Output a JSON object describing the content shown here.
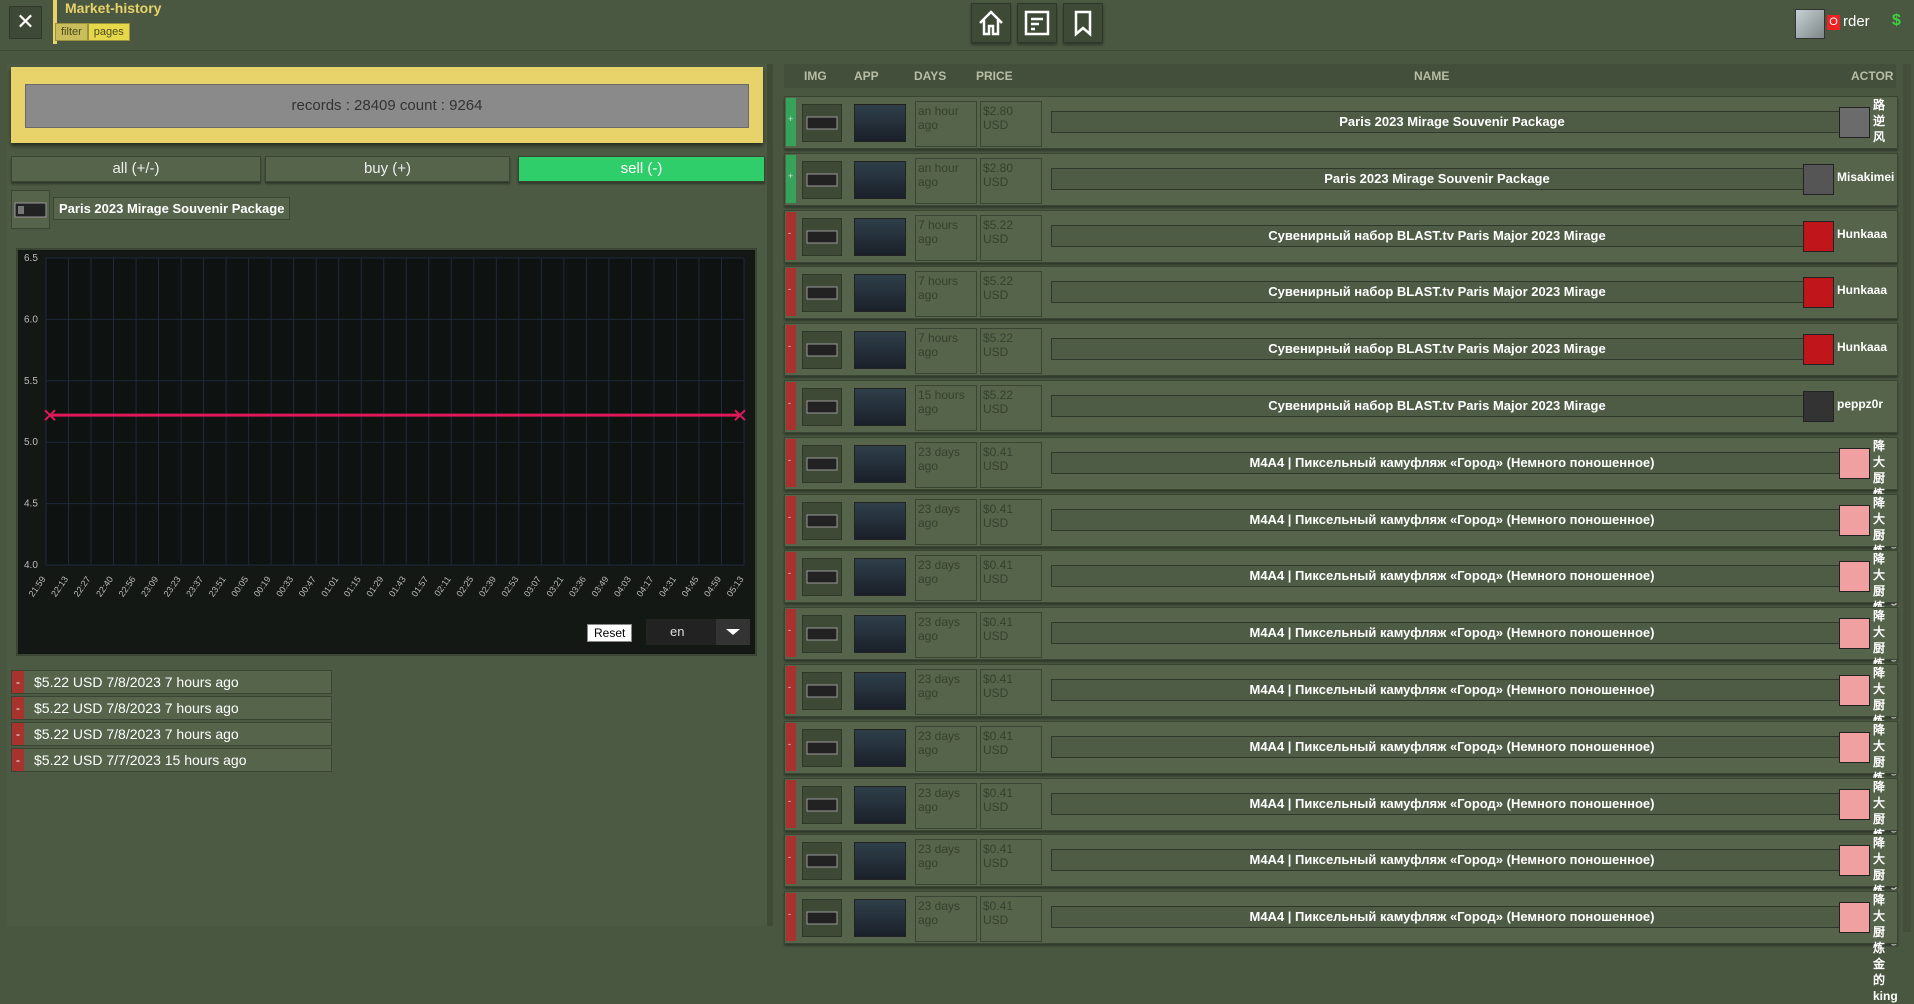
{
  "header": {
    "title": "Market-history",
    "tabs": [
      "filter",
      "pages"
    ],
    "close_label": "✕",
    "user": {
      "badge": "O",
      "name": "rder",
      "currency": "$"
    }
  },
  "left": {
    "records_text": "records : 28409 count : 9264",
    "filters": [
      "all (+/-)",
      "buy (+)",
      "sell (-)"
    ],
    "active_filter": "sell (-)",
    "item_name": "Paris 2023 Mirage Souvenir Package",
    "reset_label": "Reset",
    "lang_value": "en",
    "history": [
      {
        "sign": "-",
        "text": "$5.22 USD 7/8/2023 7 hours ago"
      },
      {
        "sign": "-",
        "text": "$5.22 USD 7/8/2023 7 hours ago"
      },
      {
        "sign": "-",
        "text": "$5.22 USD 7/8/2023 7 hours ago"
      },
      {
        "sign": "-",
        "text": "$5.22 USD 7/7/2023 15 hours ago"
      }
    ]
  },
  "chart_data": {
    "type": "line",
    "y_ticks": [
      "6.5",
      "6.0",
      "5.5",
      "5.0",
      "4.5",
      "4.0"
    ],
    "ylim": [
      4.0,
      6.5
    ],
    "x_ticks": [
      "21:59",
      "22:13",
      "22:27",
      "22:40",
      "22:56",
      "23:09",
      "23:23",
      "23:37",
      "23:51",
      "00:05",
      "00:19",
      "00:33",
      "00:47",
      "01:01",
      "01:15",
      "01:29",
      "01:43",
      "01:57",
      "02:11",
      "02:25",
      "02:39",
      "02:53",
      "03:07",
      "03:21",
      "03:36",
      "03:49",
      "04:03",
      "04:17",
      "04:31",
      "04:45",
      "04:59",
      "05:13"
    ],
    "series": [
      {
        "values": [
          5.22,
          5.22
        ]
      }
    ],
    "colors": {
      "line": "#e0195a"
    },
    "grid": true
  },
  "table": {
    "headers": {
      "img": "IMG",
      "app": "APP",
      "days": "DAYS",
      "price": "PRICE",
      "name": "NAME",
      "actor": "ACTOR"
    },
    "rows": [
      {
        "side": "buy",
        "sign": "+",
        "days": "an hour ago",
        "price": "$2.80 USD",
        "name": "Paris 2023 Mirage Souvenir Package",
        "actor": "路逆风",
        "actor_type": "cjk",
        "actor_color": "#6b6b6b"
      },
      {
        "side": "buy",
        "sign": "+",
        "days": "an hour ago",
        "price": "$2.80 USD",
        "name": "Paris 2023 Mirage Souvenir Package",
        "actor": "Misakimei",
        "actor_type": "text",
        "actor_color": "#555"
      },
      {
        "side": "sell",
        "sign": "-",
        "days": "7 hours ago",
        "price": "$5.22 USD",
        "name": "Сувенирный набор BLAST.tv Paris Major 2023 Mirage",
        "actor": "Hunkaaa",
        "actor_type": "text",
        "actor_color": "#c0151a"
      },
      {
        "side": "sell",
        "sign": "-",
        "days": "7 hours ago",
        "price": "$5.22 USD",
        "name": "Сувенирный набор BLAST.tv Paris Major 2023 Mirage",
        "actor": "Hunkaaa",
        "actor_type": "text",
        "actor_color": "#c0151a"
      },
      {
        "side": "sell",
        "sign": "-",
        "days": "7 hours ago",
        "price": "$5.22 USD",
        "name": "Сувенирный набор BLAST.tv Paris Major 2023 Mirage",
        "actor": "Hunkaaa",
        "actor_type": "text",
        "actor_color": "#c0151a"
      },
      {
        "side": "sell",
        "sign": "-",
        "days": "15 hours ago",
        "price": "$5.22 USD",
        "name": "Сувенирный набор BLAST.tv Paris Major 2023 Mirage",
        "actor": "peppz0r",
        "actor_type": "text",
        "actor_color": "#333"
      },
      {
        "side": "sell",
        "sign": "-",
        "days": "23 days ago",
        "price": "$0.41 USD",
        "name": "M4A4 | Пиксельный камуфляж «Город» (Немного поношенное)",
        "actor": "降大厨炼金的king",
        "actor_type": "cjk",
        "actor_color": "#f0a0a0"
      },
      {
        "side": "sell",
        "sign": "-",
        "days": "23 days ago",
        "price": "$0.41 USD",
        "name": "M4A4 | Пиксельный камуфляж «Город» (Немного поношенное)",
        "actor": "降大厨炼金的king",
        "actor_type": "cjk",
        "actor_color": "#f0a0a0"
      },
      {
        "side": "sell",
        "sign": "-",
        "days": "23 days ago",
        "price": "$0.41 USD",
        "name": "M4A4 | Пиксельный камуфляж «Город» (Немного поношенное)",
        "actor": "降大厨炼金的king",
        "actor_type": "cjk",
        "actor_color": "#f0a0a0"
      },
      {
        "side": "sell",
        "sign": "-",
        "days": "23 days ago",
        "price": "$0.41 USD",
        "name": "M4A4 | Пиксельный камуфляж «Город» (Немного поношенное)",
        "actor": "降大厨炼金的king",
        "actor_type": "cjk",
        "actor_color": "#f0a0a0"
      },
      {
        "side": "sell",
        "sign": "-",
        "days": "23 days ago",
        "price": "$0.41 USD",
        "name": "M4A4 | Пиксельный камуфляж «Город» (Немного поношенное)",
        "actor": "降大厨炼金的king",
        "actor_type": "cjk",
        "actor_color": "#f0a0a0"
      },
      {
        "side": "sell",
        "sign": "-",
        "days": "23 days ago",
        "price": "$0.41 USD",
        "name": "M4A4 | Пиксельный камуфляж «Город» (Немного поношенное)",
        "actor": "降大厨炼金的king",
        "actor_type": "cjk",
        "actor_color": "#f0a0a0"
      },
      {
        "side": "sell",
        "sign": "-",
        "days": "23 days ago",
        "price": "$0.41 USD",
        "name": "M4A4 | Пиксельный камуфляж «Город» (Немного поношенное)",
        "actor": "降大厨炼金的king",
        "actor_type": "cjk",
        "actor_color": "#f0a0a0"
      },
      {
        "side": "sell",
        "sign": "-",
        "days": "23 days ago",
        "price": "$0.41 USD",
        "name": "M4A4 | Пиксельный камуфляж «Город» (Немного поношенное)",
        "actor": "降大厨炼金的king",
        "actor_type": "cjk",
        "actor_color": "#f0a0a0"
      },
      {
        "side": "sell",
        "sign": "-",
        "days": "23 days ago",
        "price": "$0.41 USD",
        "name": "M4A4 | Пиксельный камуфляж «Город» (Немного поношенное)",
        "actor": "降大厨炼金的king",
        "actor_type": "cjk",
        "actor_color": "#f0a0a0"
      }
    ]
  }
}
